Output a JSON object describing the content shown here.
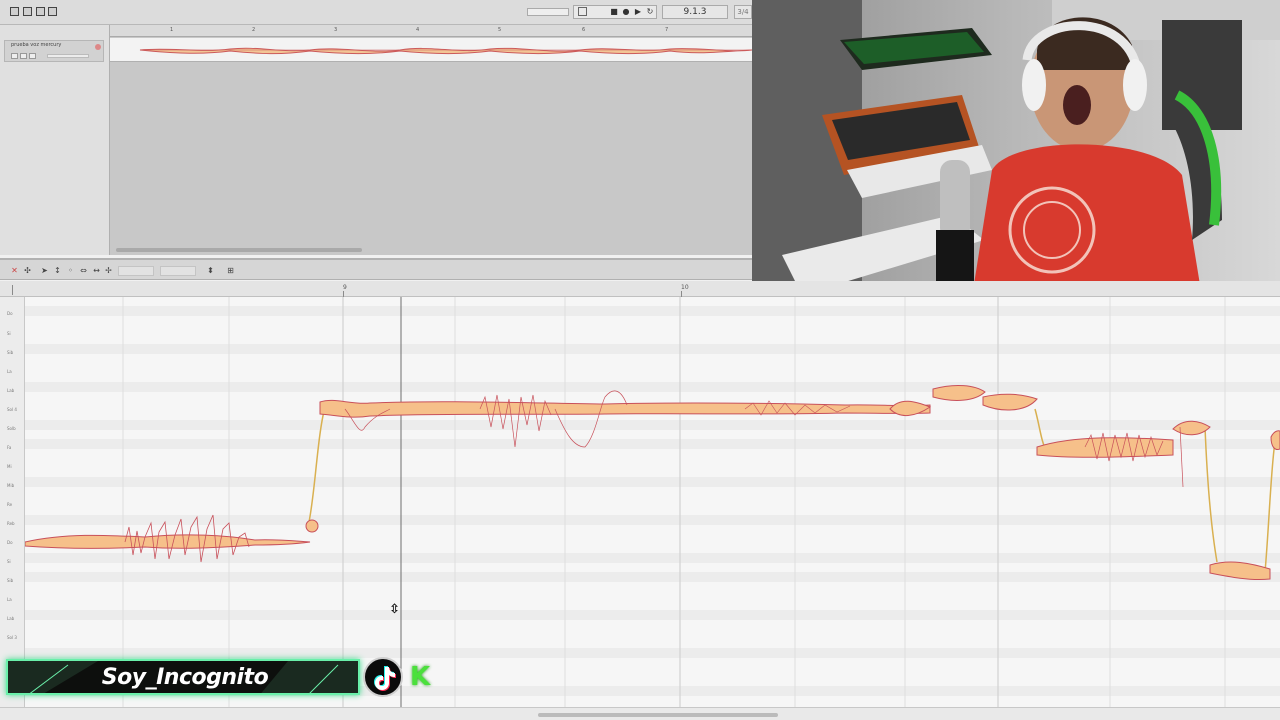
{
  "daw": {
    "toolbar": {
      "position_display": "9.1.3",
      "position_end": "3/4",
      "icons": [
        "edit-icon",
        "mixer-icon",
        "tool-icon",
        "browser-icon"
      ]
    },
    "track": {
      "name": "prueba voz mercury"
    },
    "arrange_ruler": [
      "1",
      "2",
      "3",
      "4",
      "5",
      "6",
      "7"
    ],
    "editor_ruler": [
      "9",
      "10"
    ],
    "pitch_labels": [
      "Do",
      "Si",
      "Sib",
      "La",
      "Lab",
      "Sol 4",
      "Solb",
      "Fa",
      "Mi",
      "Mib",
      "Re",
      "Reb",
      "Do",
      "Si",
      "Sib",
      "La",
      "Lab",
      "Sol 3"
    ]
  },
  "overlay": {
    "channel_name": "Soy_Incognito",
    "social_icon": "tiktok-icon",
    "brand_badge": "K",
    "accent_color": "#6af0aa",
    "badge_color": "#4be03c"
  },
  "colors": {
    "blob_fill": "#f6c08a",
    "blob_stroke": "#c8505a",
    "pitch_line": "#d9b050",
    "grid_dark_row": "#e7e7e7"
  }
}
